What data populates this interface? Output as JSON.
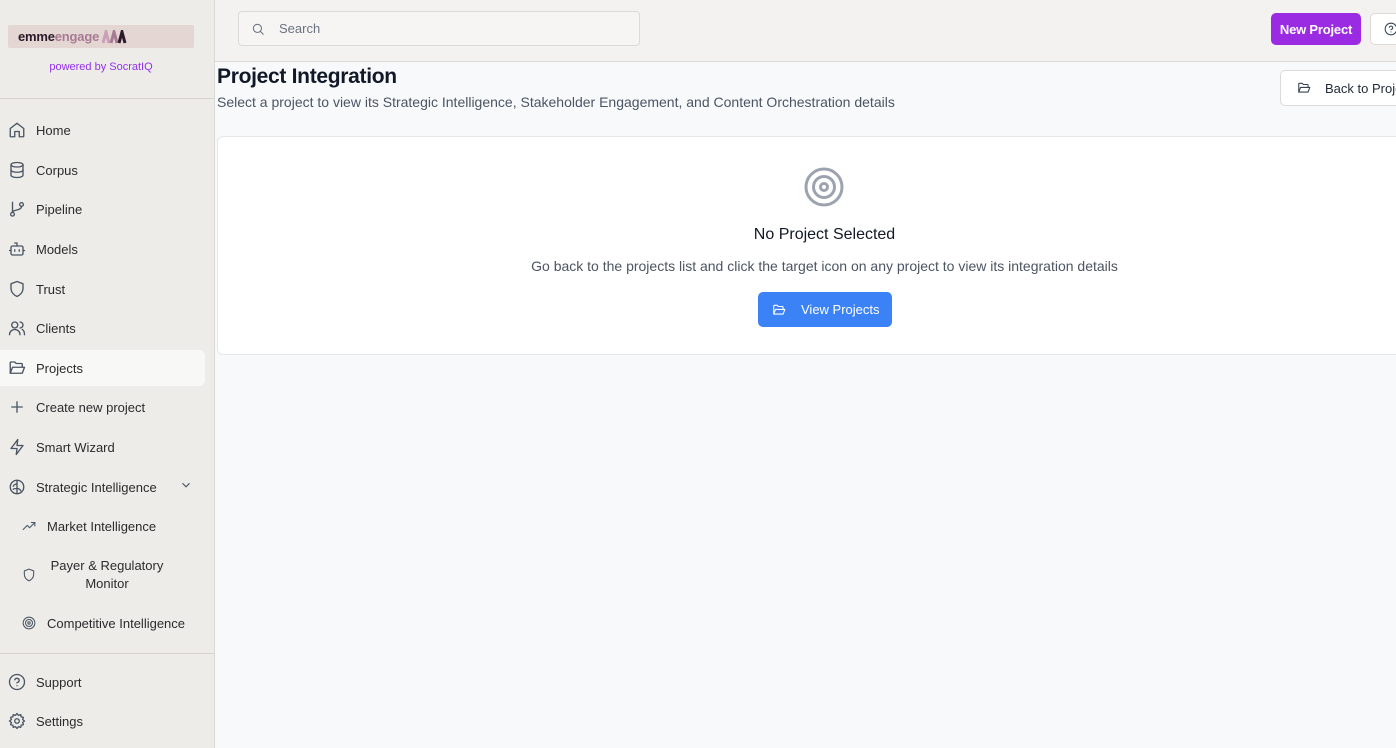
{
  "brand": {
    "name_part1": "emme",
    "name_part2": "engage",
    "powered_by": "powered by SocratIQ"
  },
  "sidebar": {
    "items": [
      {
        "label": "Home",
        "icon": "home-icon"
      },
      {
        "label": "Corpus",
        "icon": "database-icon"
      },
      {
        "label": "Pipeline",
        "icon": "git-branch-icon"
      },
      {
        "label": "Models",
        "icon": "bot-icon"
      },
      {
        "label": "Trust",
        "icon": "shield-icon"
      },
      {
        "label": "Clients",
        "icon": "users-icon"
      },
      {
        "label": "Projects",
        "icon": "folder-open-icon",
        "active": true
      },
      {
        "label": "Create new project",
        "icon": "plus-icon"
      },
      {
        "label": "Smart Wizard",
        "icon": "zap-icon"
      },
      {
        "label": "Strategic Intelligence",
        "icon": "brain-icon",
        "expanded": true
      }
    ],
    "sub_items": [
      {
        "label": "Market Intelligence",
        "icon": "trending-up-icon"
      },
      {
        "label": "Payer & Regulatory Monitor",
        "icon": "shield-icon"
      },
      {
        "label": "Competitive Intelligence",
        "icon": "target-icon"
      }
    ],
    "footer_items": [
      {
        "label": "Support",
        "icon": "help-circle-icon"
      },
      {
        "label": "Settings",
        "icon": "gear-icon"
      }
    ]
  },
  "topbar": {
    "search_placeholder": "Search",
    "new_project_label": "New Project"
  },
  "main": {
    "title": "Project Integration",
    "subtitle": "Select a project to view its Strategic Intelligence, Stakeholder Engagement, and Content Orchestration details",
    "back_label": "Back to Projects",
    "empty_state": {
      "title": "No Project Selected",
      "text": "Go back to the projects list and click the target icon on any project to view its integration details",
      "button_label": "View Projects"
    }
  },
  "colors": {
    "accent_purple": "#9b2be3",
    "button_blue": "#3b82f6",
    "sidebar_bg": "#edece9"
  }
}
